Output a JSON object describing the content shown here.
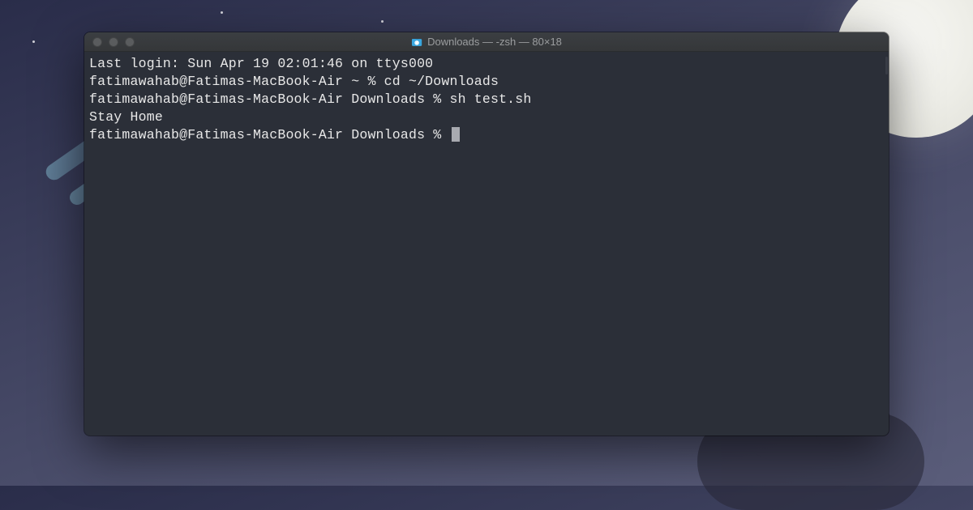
{
  "titlebar": {
    "title": "Downloads — -zsh — 80×18"
  },
  "terminal": {
    "lines": {
      "0": "Last login: Sun Apr 19 02:01:46 on ttys000",
      "1": "fatimawahab@Fatimas-MacBook-Air ~ % cd ~/Downloads",
      "2": "fatimawahab@Fatimas-MacBook-Air Downloads % sh test.sh",
      "3": "Stay Home",
      "4": "fatimawahab@Fatimas-MacBook-Air Downloads % "
    }
  }
}
